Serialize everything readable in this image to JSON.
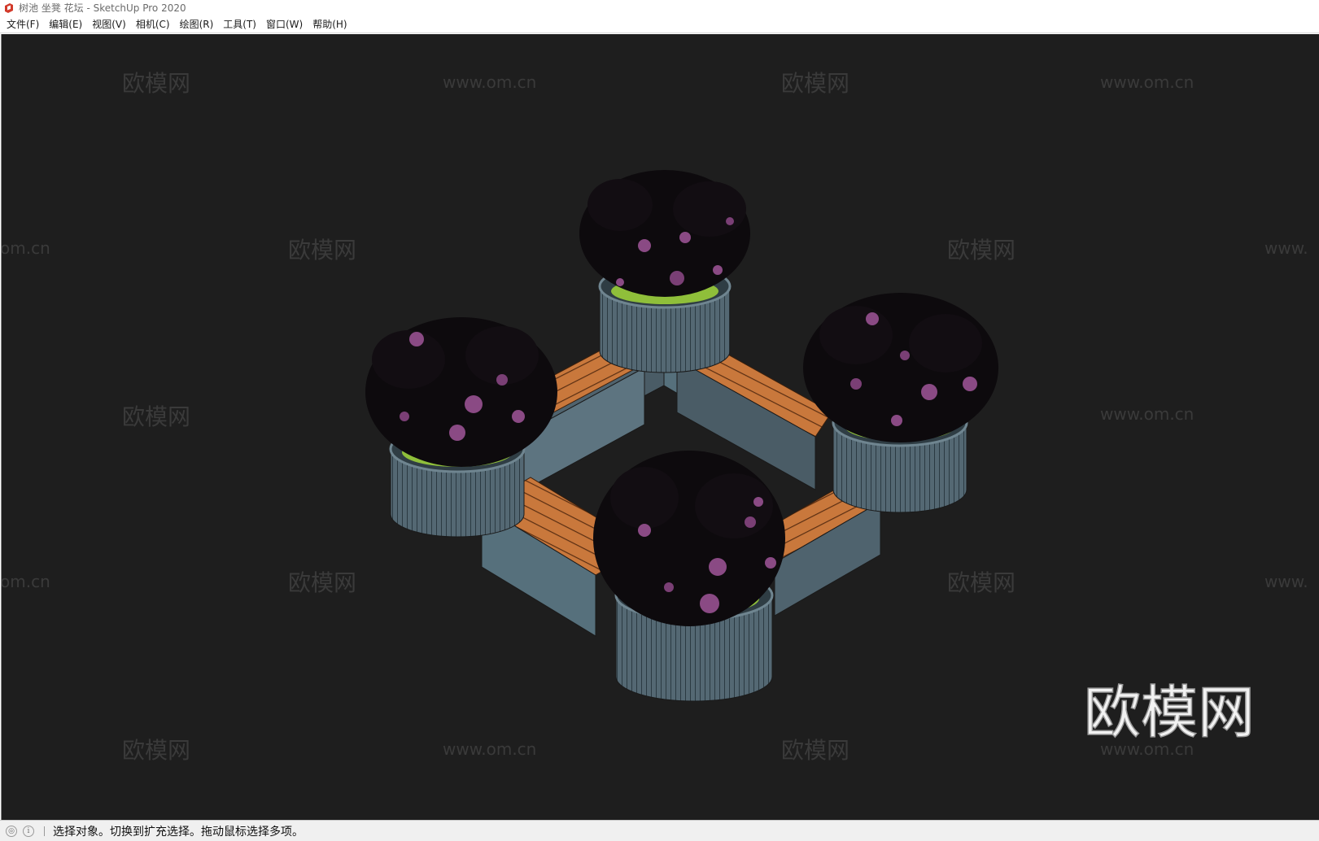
{
  "window": {
    "title": "树池 坐凳 花坛 - SketchUp Pro 2020",
    "accent_color": "#d23a2a"
  },
  "menu": {
    "items": [
      {
        "label": "文件(F)"
      },
      {
        "label": "编辑(E)"
      },
      {
        "label": "视图(V)"
      },
      {
        "label": "相机(C)"
      },
      {
        "label": "绘图(R)"
      },
      {
        "label": "工具(T)"
      },
      {
        "label": "窗口(W)"
      },
      {
        "label": "帮助(H)"
      }
    ]
  },
  "viewport": {
    "background": "#1e1e1e",
    "model": "square-planter-bench",
    "colors": {
      "planter_wall": "#546873",
      "wood": "#c9783c",
      "foliage": "#0d0a0d",
      "flower": "#8a4a84",
      "grass": "#8fbf3a"
    }
  },
  "watermark": {
    "brand": "欧模网",
    "url": "www.om.cn",
    "url_partial_left": "om.cn",
    "url_partial_right": "www."
  },
  "statusbar": {
    "icon_1": "geo-location-icon",
    "icon_2": "info-icon",
    "message": "选择对象。切换到扩充选择。拖动鼠标选择多项。"
  }
}
